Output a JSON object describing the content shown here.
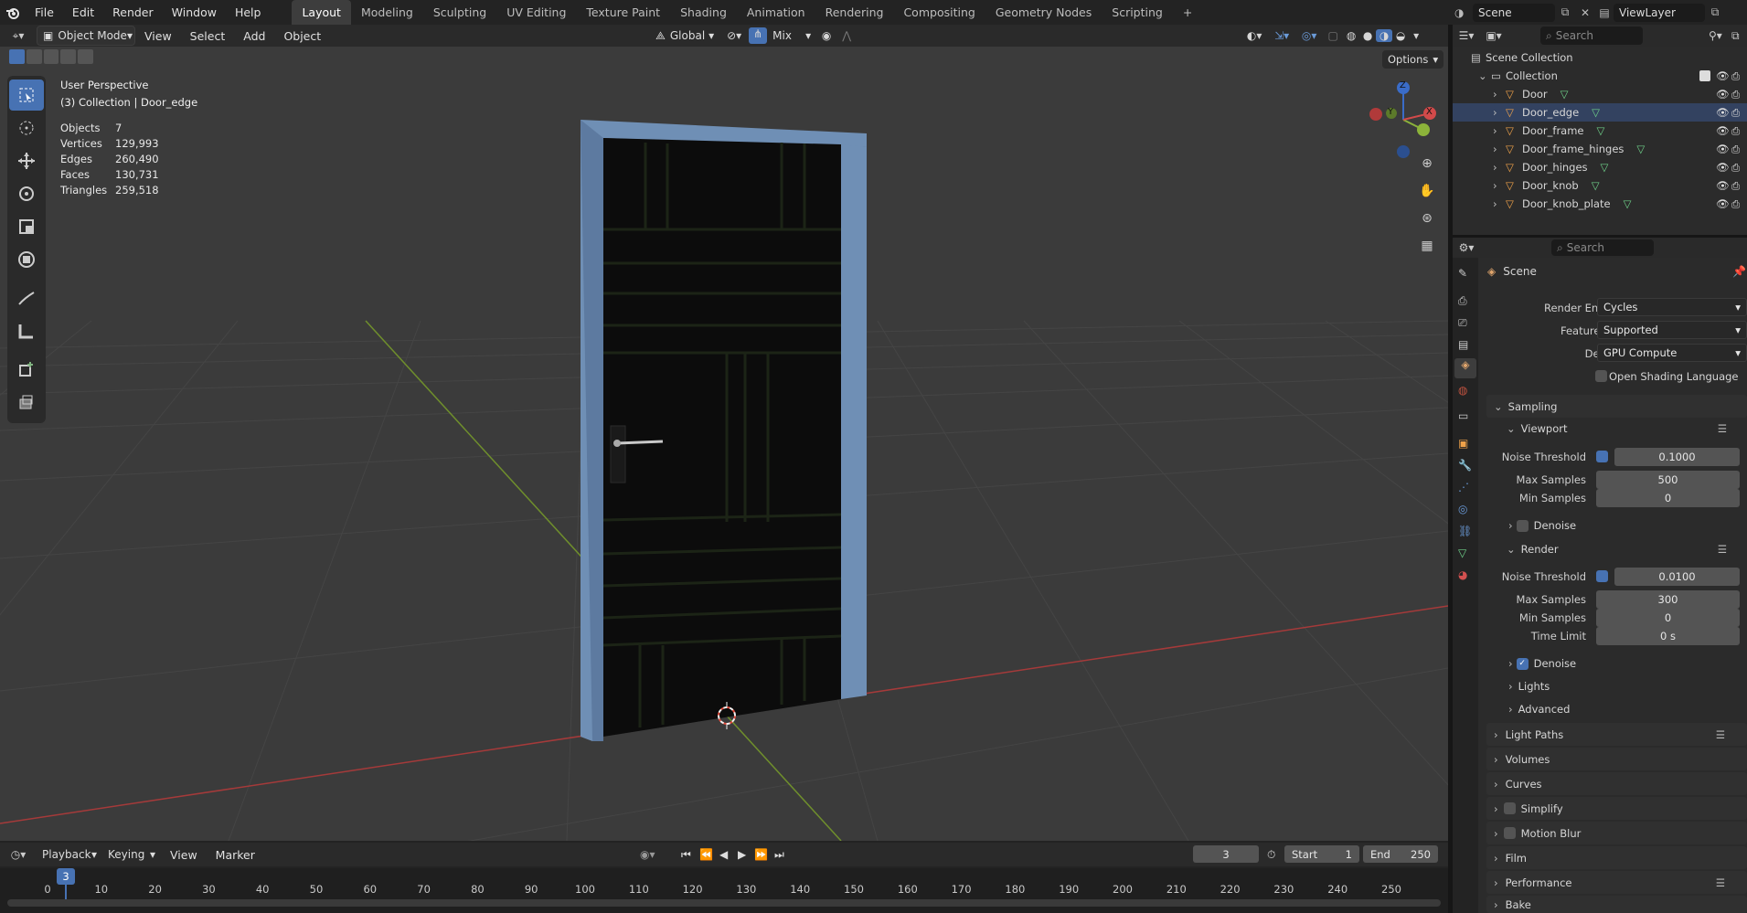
{
  "menu": {
    "file": "File",
    "edit": "Edit",
    "render": "Render",
    "window": "Window",
    "help": "Help"
  },
  "workspaces": [
    "Layout",
    "Modeling",
    "Sculpting",
    "UV Editing",
    "Texture Paint",
    "Shading",
    "Animation",
    "Rendering",
    "Compositing",
    "Geometry Nodes",
    "Scripting"
  ],
  "active_workspace": "Layout",
  "scene_name": "Scene",
  "view_layer": "ViewLayer",
  "viewport_header": {
    "mode": "Object Mode",
    "view": "View",
    "select": "Select",
    "add": "Add",
    "object": "Object",
    "orientation": "Global",
    "blend": "Mix",
    "options": "Options"
  },
  "overlay": {
    "perspective": "User Perspective",
    "collection": "(3) Collection | Door_edge",
    "stats": [
      {
        "label": "Objects",
        "value": "7"
      },
      {
        "label": "Vertices",
        "value": "129,993"
      },
      {
        "label": "Edges",
        "value": "260,490"
      },
      {
        "label": "Faces",
        "value": "130,731"
      },
      {
        "label": "Triangles",
        "value": "259,518"
      }
    ]
  },
  "gizmo": {
    "z": "Z",
    "y": "Y",
    "x": "X"
  },
  "outliner": {
    "search_placeholder": "Search",
    "scene_collection": "Scene Collection",
    "collection": "Collection",
    "objects": [
      "Door",
      "Door_edge",
      "Door_frame",
      "Door_frame_hinges",
      "Door_hinges",
      "Door_knob",
      "Door_knob_plate"
    ]
  },
  "properties": {
    "search_placeholder": "Search",
    "context": "Scene",
    "render_engine_label": "Render Engine",
    "render_engine": "Cycles",
    "feature_set_label": "Feature Set",
    "feature_set": "Supported",
    "device_label": "Device",
    "device": "GPU Compute",
    "osl_label": "Open Shading Language",
    "sampling": "Sampling",
    "viewport": "Viewport",
    "vp_noise_label": "Noise Threshold",
    "vp_noise": "0.1000",
    "vp_max_label": "Max Samples",
    "vp_max": "500",
    "vp_min_label": "Min Samples",
    "vp_min": "0",
    "vp_denoise": "Denoise",
    "render": "Render",
    "r_noise_label": "Noise Threshold",
    "r_noise": "0.0100",
    "r_max_label": "Max Samples",
    "r_max": "300",
    "r_min_label": "Min Samples",
    "r_min": "0",
    "r_time_label": "Time Limit",
    "r_time": "0 s",
    "r_denoise": "Denoise",
    "lights": "Lights",
    "advanced": "Advanced",
    "sections": [
      "Light Paths",
      "Volumes",
      "Curves",
      "Simplify",
      "Motion Blur",
      "Film",
      "Performance",
      "Bake"
    ]
  },
  "timeline": {
    "playback": "Playback",
    "keying": "Keying",
    "view": "View",
    "marker": "Marker",
    "current_frame": "3",
    "start_label": "Start",
    "start": "1",
    "end_label": "End",
    "end": "250",
    "ticks": [
      "0",
      "10",
      "20",
      "30",
      "40",
      "50",
      "60",
      "70",
      "80",
      "90",
      "100",
      "110",
      "120",
      "130",
      "140",
      "150",
      "160",
      "170",
      "180",
      "190",
      "200",
      "210",
      "220",
      "230",
      "240",
      "250"
    ]
  },
  "colors": {
    "accent": "#4772b3",
    "x_axis": "#a53a3a",
    "y_axis": "#6f8f2c",
    "door_frame": "#6f8fb5",
    "background": "#3a3a3a"
  }
}
